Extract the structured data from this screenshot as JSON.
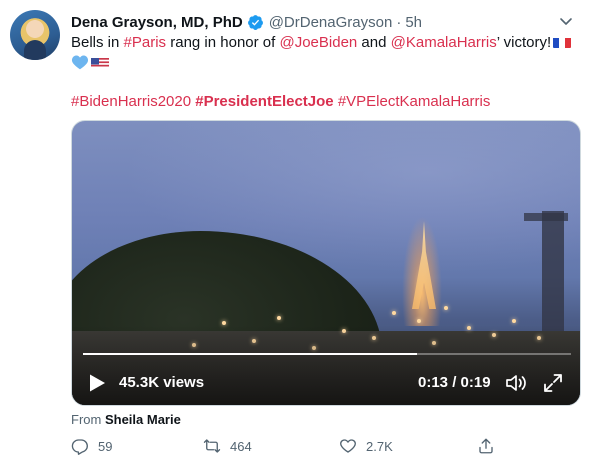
{
  "tweet": {
    "author_name": "Dena Grayson, MD, PhD",
    "handle": "@DrDenaGrayson",
    "separator": "·",
    "time": "5h",
    "text": {
      "part1": "Bells in ",
      "link_paris": "#Paris",
      "part2": " rang in honor of ",
      "link_biden": "@JoeBiden",
      "part3": " and ",
      "link_harris": "@KamalaHarris",
      "part4": "’ victory!"
    },
    "hashtags": {
      "tag1": "#BidenHarris2020",
      "tag2": "#PresidentElectJoe",
      "tag3": "#VPElectKamalaHarris"
    },
    "video": {
      "views": "45.3K views",
      "timecode": "0:13 / 0:19",
      "progress_percent": 68.4
    },
    "from": {
      "label": "From",
      "source": "Sheila Marie"
    },
    "actions": {
      "replies": "59",
      "retweets": "464",
      "likes": "2.7K"
    }
  },
  "colors": {
    "link": "#d9304f",
    "verified": "#1d9bf0",
    "muted": "#536471"
  },
  "icons": [
    "verified-badge-icon",
    "chevron-down-icon",
    "heart-emoji-icon",
    "play-icon",
    "volume-icon",
    "fullscreen-icon",
    "reply-icon",
    "retweet-icon",
    "like-icon",
    "share-icon"
  ]
}
